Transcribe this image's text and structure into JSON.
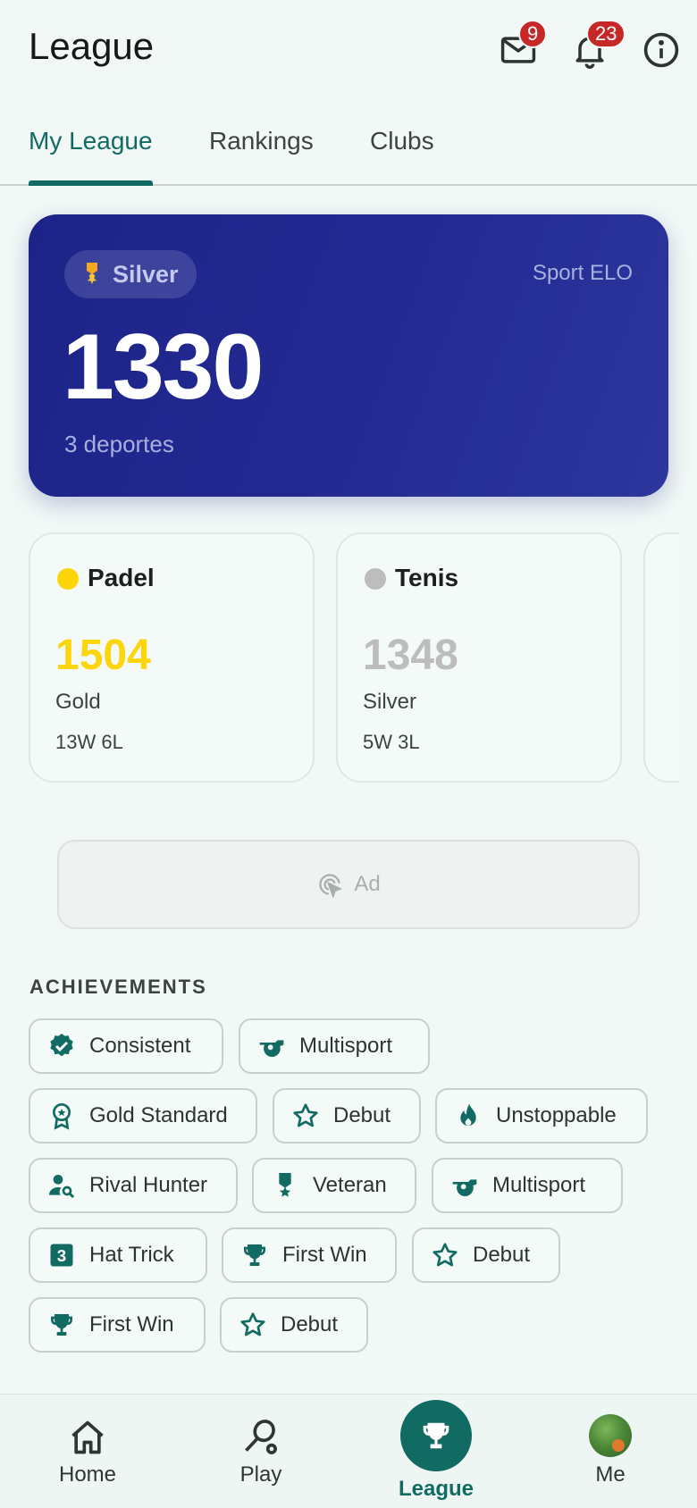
{
  "header": {
    "title": "League",
    "mail_count": "9",
    "notification_count": "23"
  },
  "tabs": [
    {
      "label": "My League",
      "active": true
    },
    {
      "label": "Rankings",
      "active": false
    },
    {
      "label": "Clubs",
      "active": false
    }
  ],
  "elo_card": {
    "tier_label": "Silver",
    "tier_icon": "medal-icon",
    "caption": "Sport ELO",
    "value": "1330",
    "subtitle": "3 deportes"
  },
  "sports": [
    {
      "name": "Padel",
      "rating": "1504",
      "tier": "Gold",
      "record": "13W 6L",
      "color": "#fdd50b"
    },
    {
      "name": "Tenis",
      "rating": "1348",
      "tier": "Silver",
      "record": "5W 3L",
      "color": "#bdbdbd"
    }
  ],
  "ad": {
    "label": "Ad",
    "icon": "ad-cursor-icon"
  },
  "achievements": {
    "title": "ACHIEVEMENTS",
    "items": [
      {
        "label": "Consistent",
        "icon": "verified-badge-icon"
      },
      {
        "label": "Multisport",
        "icon": "whistle-icon"
      },
      {
        "label": "Gold Standard",
        "icon": "award-ribbon-icon"
      },
      {
        "label": "Debut",
        "icon": "star-outline-icon"
      },
      {
        "label": "Unstoppable",
        "icon": "flame-icon"
      },
      {
        "label": "Rival Hunter",
        "icon": "person-search-icon"
      },
      {
        "label": "Veteran",
        "icon": "military-medal-icon"
      },
      {
        "label": "Multisport",
        "icon": "whistle-icon"
      },
      {
        "label": "Hat Trick",
        "icon": "number-three-icon"
      },
      {
        "label": "First Win",
        "icon": "trophy-icon"
      },
      {
        "label": "Debut",
        "icon": "star-outline-icon"
      },
      {
        "label": "First Win",
        "icon": "trophy-icon"
      },
      {
        "label": "Debut",
        "icon": "star-outline-icon"
      }
    ]
  },
  "bottom_nav": [
    {
      "label": "Home",
      "icon": "home-icon"
    },
    {
      "label": "Play",
      "icon": "racket-icon"
    },
    {
      "label": "League",
      "icon": "trophy-icon",
      "active": true
    },
    {
      "label": "Me",
      "icon": "avatar"
    }
  ],
  "colors": {
    "accent": "#126b63",
    "card_blue": "#1c2388",
    "badge_red": "#c62828",
    "background": "#f1f8f6"
  }
}
